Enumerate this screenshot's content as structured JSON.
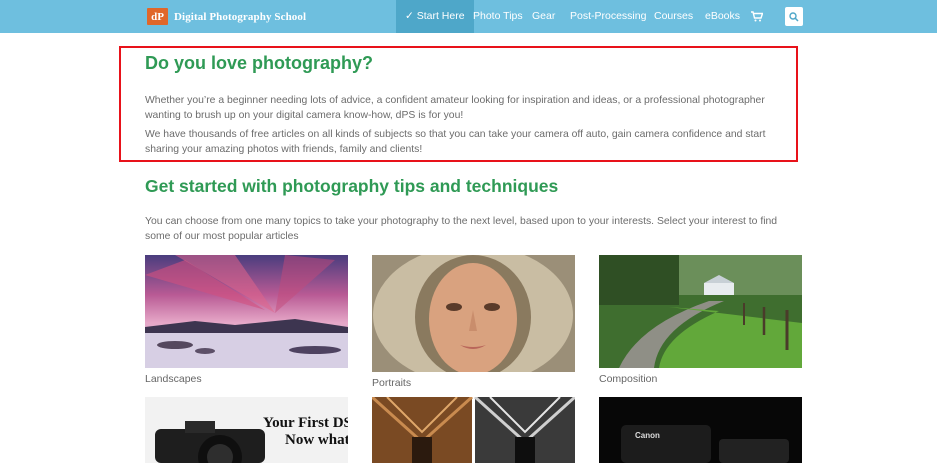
{
  "nav": {
    "brand_logo": "dP",
    "brand_name": "Digital Photography School",
    "start_here": "✓ Start Here",
    "items": [
      "Photo Tips",
      "Gear",
      "Post-Processing",
      "Courses",
      "eBooks"
    ]
  },
  "intro": {
    "heading": "Do you love photography?",
    "para1_line1": "Whether you’re a beginner needing lots of advice, a confident amateur looking for inspiration and ideas, or a professional photographer",
    "para1_line2": "wanting to brush up on your digital camera know-how, dPS is for you!",
    "para2_line1": "We have thousands of free articles on all kinds of subjects so that you can take your camera off auto, gain camera confidence and start",
    "para2_line2": "sharing your amazing photos with friends, family and clients!"
  },
  "topics": {
    "heading": "Get started with photography tips and techniques",
    "desc_line1": "You can choose from one many topics to take your photography to the next level, based upon to your interests. Select your interest to find",
    "desc_line2": "some of our most popular articles",
    "tiles": [
      {
        "caption": "Landscapes"
      },
      {
        "caption": "Portraits"
      },
      {
        "caption": "Composition"
      }
    ],
    "dslr_text_line1": "Your First DSLR",
    "dslr_text_line2": "Now what?!",
    "camera_brand": "Canon"
  },
  "colors": {
    "nav_bg": "#6ebfdf",
    "nav_active": "#4ea7c9",
    "heading_green": "#2f9a55",
    "highlight_border": "#e8121a",
    "logo_orange": "#e0672a"
  }
}
